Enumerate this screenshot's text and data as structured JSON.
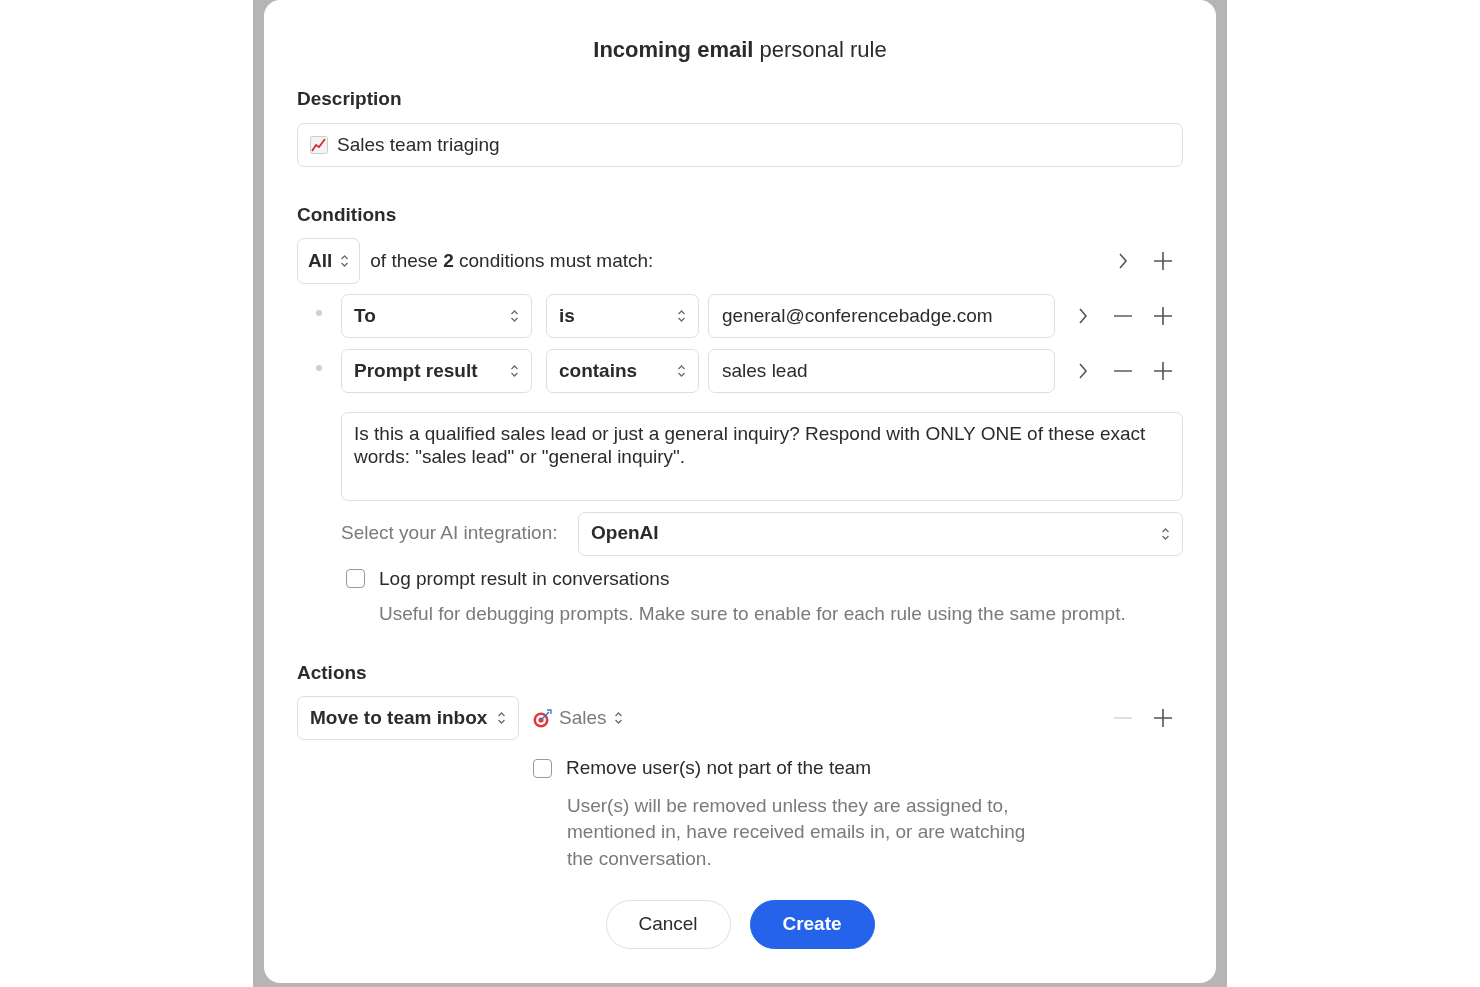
{
  "dialog": {
    "title": "**Incoming email** personal rule"
  },
  "description": {
    "label": "Description",
    "value": "Sales team triaging"
  },
  "conditions": {
    "label": "Conditions",
    "match_mode": "All",
    "summary": "of these **2** conditions must match:",
    "rows": [
      {
        "field": "To",
        "operator": "is",
        "value": "general@conferencebadge.com",
        "remove_disabled": false
      },
      {
        "field": "Prompt result",
        "operator": "contains",
        "value": "sales lead",
        "remove_disabled": false
      }
    ],
    "prompt": "Is this a qualified sales lead or just a general inquiry? Respond with ONLY ONE of these exact words: \"sales lead\" or \"general inquiry\".",
    "ai_label": "Select your AI integration:",
    "ai_value": "OpenAI",
    "log_option": {
      "label": "Log prompt result in conversations",
      "checked": false,
      "hint": "Useful for debugging prompts. Make sure to enable for each rule using the same prompt."
    }
  },
  "actions": {
    "label": "Actions",
    "action": "Move to team inbox",
    "team": "Sales",
    "remove_disabled": true,
    "remove_option": {
      "label": "Remove user(s) not part of the team",
      "checked": false,
      "hint": "User(s) will be removed unless they are assigned to, mentioned in, have received emails in, or are watching the conversation."
    }
  },
  "buttons": [
    {
      "label": "Cancel",
      "kind": "secondary"
    },
    {
      "label": "Create",
      "kind": "primary"
    }
  ]
}
